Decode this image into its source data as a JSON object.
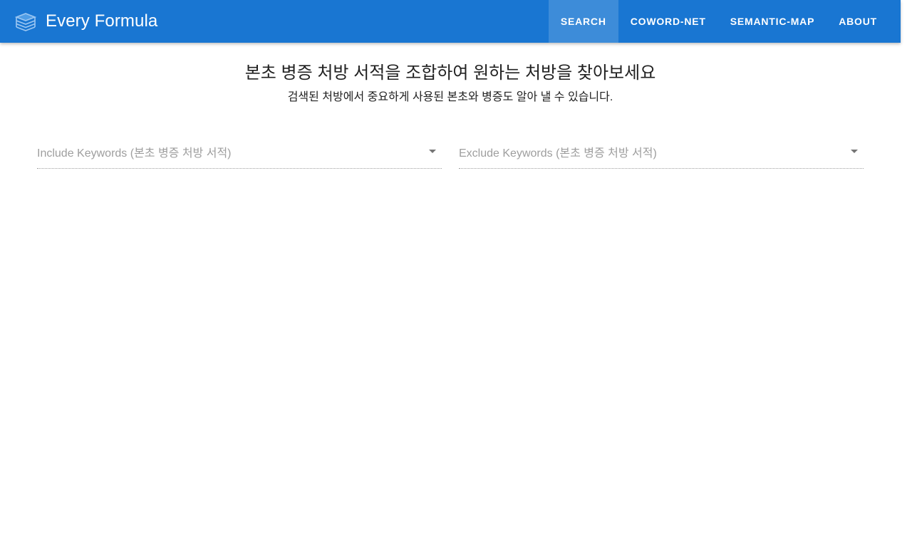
{
  "header": {
    "title": "Every Formula",
    "logo_icon": "layers-icon",
    "nav": [
      {
        "label": "SEARCH",
        "active": true
      },
      {
        "label": "COWORD-NET",
        "active": false
      },
      {
        "label": "SEMANTIC-MAP",
        "active": false
      },
      {
        "label": "ABOUT",
        "active": false
      }
    ]
  },
  "main": {
    "headline": "본초 병증 처방 서적을 조합하여 원하는 처방을 찾아보세요",
    "subline": "검색된 처방에서 중요하게 사용된 본초와 병증도 알아 낼 수 있습니다.",
    "include": {
      "placeholder": "Include Keywords (본초 병증 처방 서적)"
    },
    "exclude": {
      "placeholder": "Exclude Keywords (본초 병증 처방 서적)"
    }
  },
  "colors": {
    "primary": "#1976d2",
    "placeholder": "#9e9e9e"
  }
}
